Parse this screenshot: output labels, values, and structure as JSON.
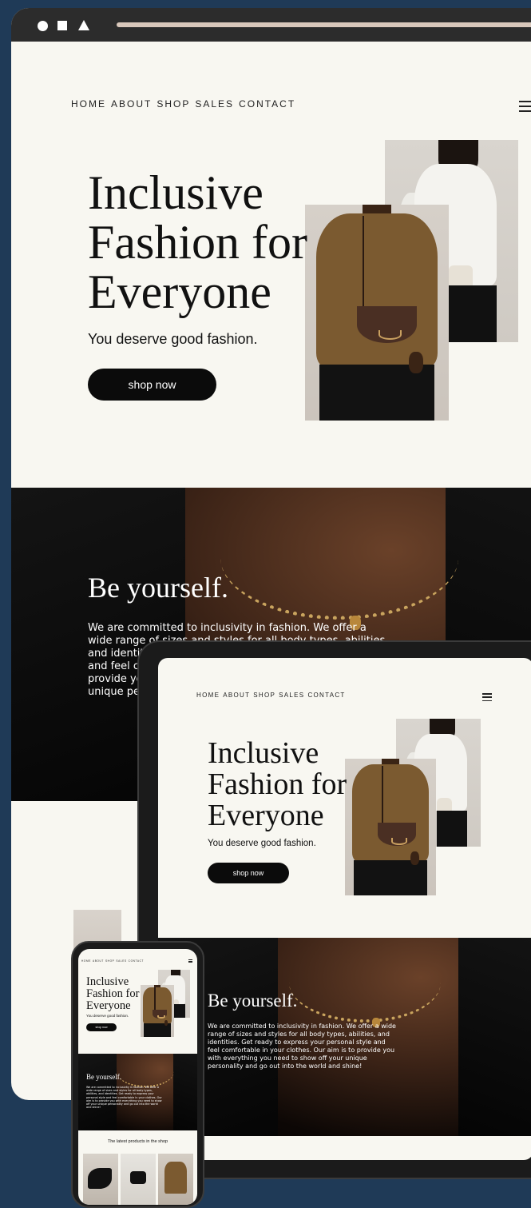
{
  "desktop": {
    "nav": [
      "HOME",
      "ABOUT",
      "SHOP",
      "SALES",
      "CONTACT"
    ],
    "hero_title_lines": [
      "Inclusive",
      "Fashion for",
      "Everyone"
    ],
    "hero_subtitle": "You deserve good fashion.",
    "cta_label": "shop now",
    "banner_title": "Be yourself.",
    "banner_text": "We are committed to inclusivity in fashion. We offer a wide range of sizes and styles for all body types, abilities, and identities. Get ready to express your personal style and feel comfortable in your clothes. Our aim is to provide you with everything you need to show off your unique personality and go out into the world and shine!"
  },
  "tablet": {
    "nav": [
      "HOME",
      "ABOUT",
      "SHOP",
      "SALES",
      "CONTACT"
    ],
    "hero_title_lines": [
      "Inclusive",
      "Fashion for",
      "Everyone"
    ],
    "hero_subtitle": "You deserve good fashion.",
    "cta_label": "shop now",
    "banner_title": "Be yourself.",
    "banner_text": "We are committed to inclusivity in fashion. We offer a wide range of sizes and styles for all body types, abilities, and identities. Get ready to express your personal style and feel comfortable in your clothes. Our aim is to provide you with everything you need to show off your unique personality and go out into the world and shine!"
  },
  "phone": {
    "nav": [
      "HOME",
      "ABOUT",
      "SHOP",
      "SALES",
      "CONTACT"
    ],
    "hero_title_lines": [
      "Inclusive",
      "Fashion for",
      "Everyone"
    ],
    "hero_subtitle": "You deserve good fashion.",
    "cta_label": "shop now",
    "banner_title": "Be yourself.",
    "banner_text": "We are committed to inclusivity in fashion. We offer a wide range of sizes and styles for all body types, abilities, and identities. Get ready to express your personal style and feel comfortable in your clothes. Our aim is to provide you with everything you need to show off your unique personality and go out into the world and shine!",
    "products_heading": "The latest products in the shop"
  },
  "colors": {
    "background": "#1f3a57",
    "page": "#f8f7f1",
    "button": "#0b0b0b",
    "address_bar": "#d9c8bb"
  },
  "icons": [
    "circle-icon",
    "square-icon",
    "triangle-icon",
    "hamburger-menu-icon"
  ]
}
